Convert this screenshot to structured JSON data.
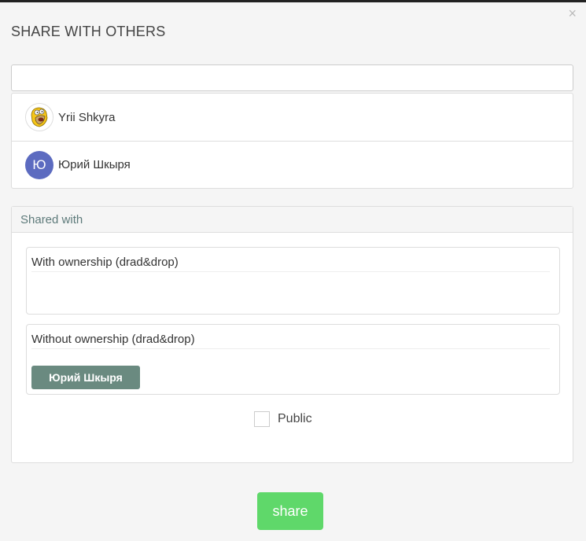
{
  "modal": {
    "title": "SHARE WITH OTHERS",
    "close_symbol": "×"
  },
  "search": {
    "value": "",
    "placeholder": ""
  },
  "users": [
    {
      "name": "Yrii Shkyra",
      "avatar": "cartoon-character-avatar"
    },
    {
      "name": "Юрий Шкыря",
      "avatar_letter": "Ю",
      "avatar_color": "#5c6bc0"
    }
  ],
  "shared": {
    "header": "Shared with",
    "with_ownership_label": "With ownership (drad&drop)",
    "without_ownership_label": "Without ownership (drad&drop)",
    "without_ownership_items": [
      "Юрий Шкыря"
    ],
    "public_label": "Public",
    "public_checked": false
  },
  "actions": {
    "share_label": "share"
  },
  "colors": {
    "share_button": "#5fd86a",
    "chip": "#6a8a80",
    "avatar_letter_bg": "#5c6bc0",
    "header_text": "#5d7a7a"
  }
}
